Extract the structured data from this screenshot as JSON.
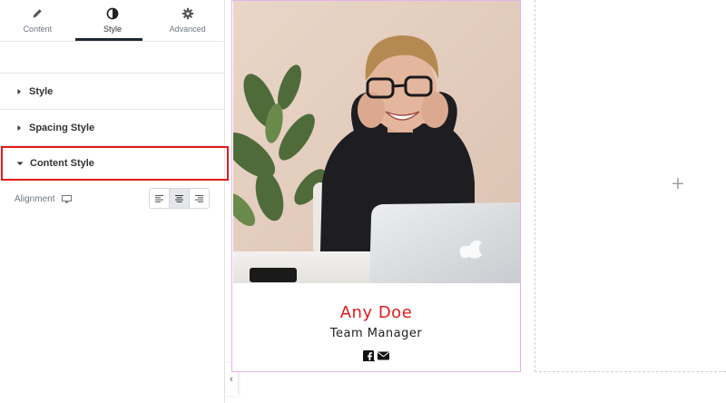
{
  "panel": {
    "tabs": [
      {
        "label": "Content",
        "icon": "pencil-icon",
        "active": false
      },
      {
        "label": "Style",
        "icon": "half-circle-icon",
        "active": true
      },
      {
        "label": "Advanced",
        "icon": "gear-icon",
        "active": false
      }
    ],
    "sections": [
      {
        "label": "Style",
        "expanded": false
      },
      {
        "label": "Spacing Style",
        "expanded": false
      },
      {
        "label": "Content Style",
        "expanded": true,
        "highlighted": true
      }
    ],
    "alignment": {
      "label": "Alignment",
      "device_icon": "desktop-monitor-icon",
      "options": [
        "align-left",
        "align-center",
        "align-right"
      ],
      "selected": "align-center"
    },
    "collapse_glyph": "‹"
  },
  "card": {
    "name": "Any Doe",
    "role": "Team Manager",
    "socials": [
      "facebook-icon",
      "envelope-icon"
    ]
  },
  "canvas": {
    "add_glyph": "+"
  },
  "colors": {
    "name_color": "#e11b1b",
    "highlight_border": "#e11b1b",
    "card_border": "#e3b4e8"
  }
}
